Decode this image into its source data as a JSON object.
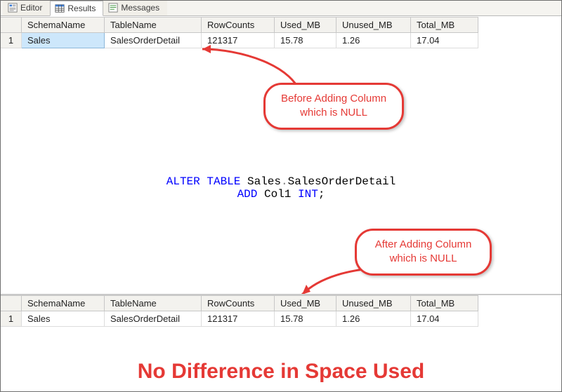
{
  "tabs": {
    "editor": "Editor",
    "results": "Results",
    "messages": "Messages"
  },
  "columns": {
    "schema": "SchemaName",
    "table": "TableName",
    "rowc": "RowCounts",
    "used": "Used_MB",
    "unused": "Unused_MB",
    "total": "Total_MB"
  },
  "rows": {
    "before": {
      "n": "1",
      "schema": "Sales",
      "table": "SalesOrderDetail",
      "rowc": "121317",
      "used": "15.78",
      "unused": "1.26",
      "total": "17.04"
    },
    "after": {
      "n": "1",
      "schema": "Sales",
      "table": "SalesOrderDetail",
      "rowc": "121317",
      "used": "15.78",
      "unused": "1.26",
      "total": "17.04"
    }
  },
  "sql": {
    "kw_alter": "ALTER",
    "kw_table": "TABLE",
    "schema": "Sales",
    "dot": ".",
    "tname": "SalesOrderDetail",
    "kw_add": "ADD",
    "col": "Col1",
    "ty_int": "INT",
    "semi": ";"
  },
  "callout_before": {
    "line1": "Before Adding Column",
    "line2": "which is NULL"
  },
  "callout_after": {
    "line1": "After Adding Column",
    "line2": "which is NULL"
  },
  "caption": "No Difference in Space Used"
}
